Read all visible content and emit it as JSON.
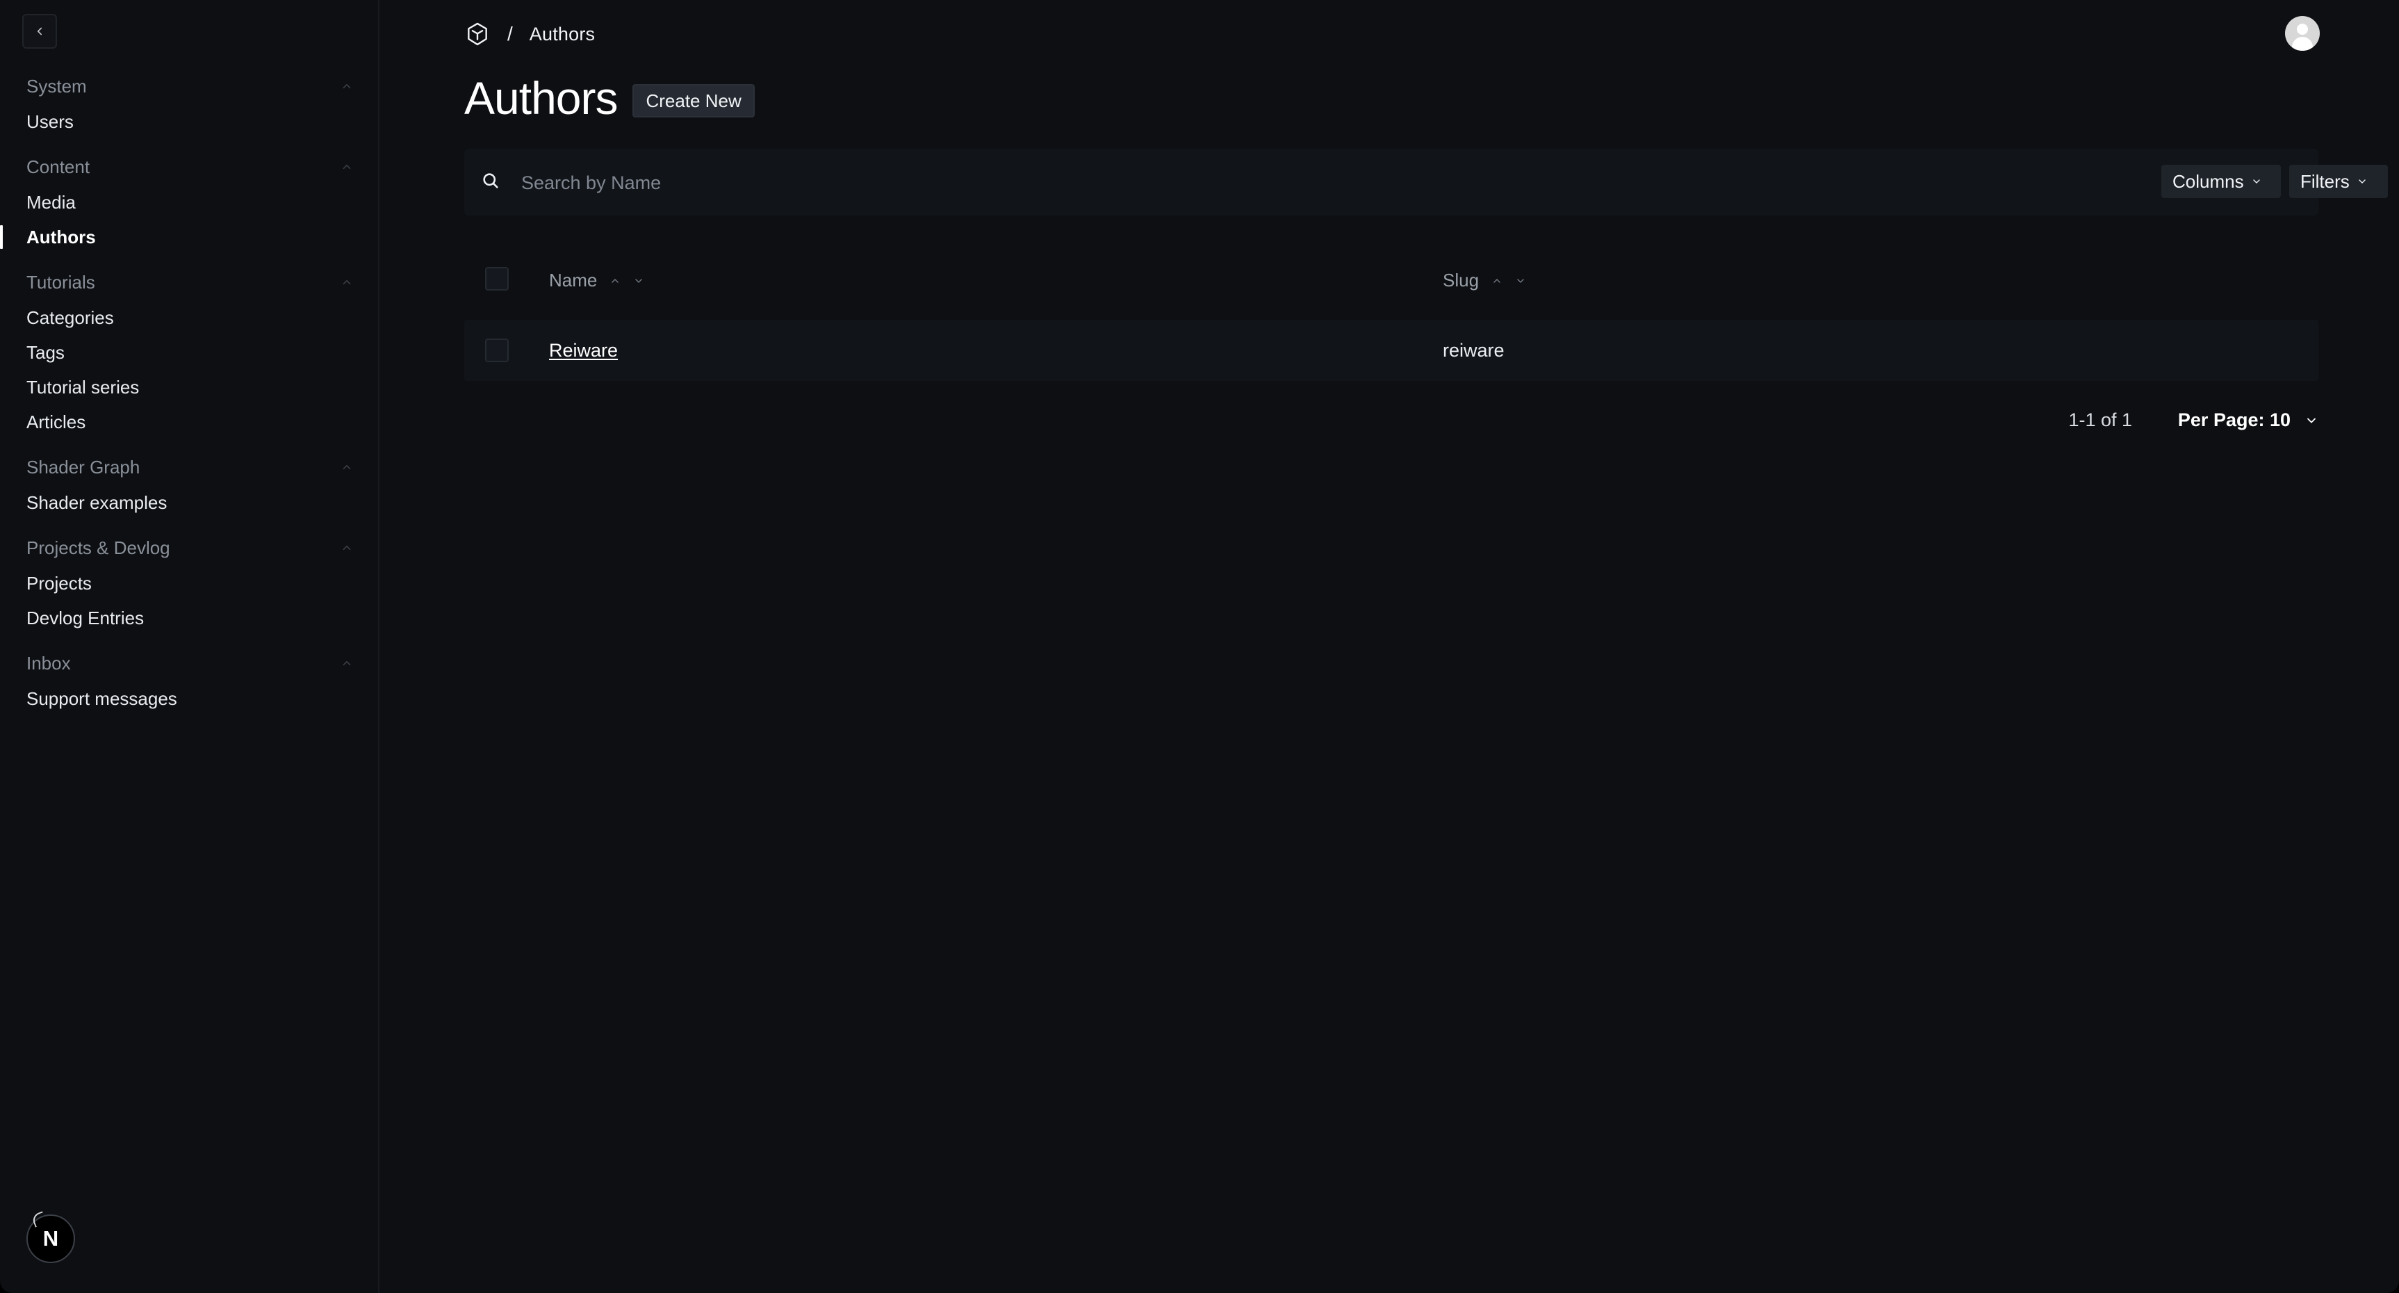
{
  "colors": {
    "background": "#0d0f13",
    "surface": "#111419",
    "text": "#f5f6f7",
    "muted": "#8a9099",
    "button": "#262b33"
  },
  "icons": {
    "collapse": "chevron-left-icon",
    "logo": "payload-logo-icon",
    "avatar": "user-avatar-icon",
    "search": "search-icon",
    "chevron": "chevron-down-icon",
    "sort_up": "chevron-up-icon",
    "sort_down": "chevron-down-icon",
    "framework": "nextjs-icon"
  },
  "sidebar": {
    "groups": [
      {
        "label": "System",
        "items": [
          {
            "label": "Users"
          }
        ]
      },
      {
        "label": "Content",
        "items": [
          {
            "label": "Media"
          },
          {
            "label": "Authors",
            "active": true
          }
        ]
      },
      {
        "label": "Tutorials",
        "items": [
          {
            "label": "Categories"
          },
          {
            "label": "Tags"
          },
          {
            "label": "Tutorial series"
          },
          {
            "label": "Articles"
          }
        ]
      },
      {
        "label": "Shader Graph",
        "items": [
          {
            "label": "Shader examples"
          }
        ]
      },
      {
        "label": "Projects & Devlog",
        "items": [
          {
            "label": "Projects"
          },
          {
            "label": "Devlog Entries"
          }
        ]
      },
      {
        "label": "Inbox",
        "items": [
          {
            "label": "Support messages"
          }
        ]
      }
    ],
    "badge": "N"
  },
  "header": {
    "breadcrumb_separator": "/",
    "breadcrumb": "Authors"
  },
  "main": {
    "title": "Authors",
    "create_button": "Create New",
    "search_placeholder": "Search by Name",
    "columns_button": "Columns",
    "filters_button": "Filters",
    "columns": [
      {
        "label": "Name"
      },
      {
        "label": "Slug"
      }
    ],
    "rows": [
      {
        "name": "Reiware",
        "slug": "reiware"
      }
    ],
    "pagination": {
      "range": "1-1 of 1",
      "per_page": "Per Page: 10"
    }
  }
}
